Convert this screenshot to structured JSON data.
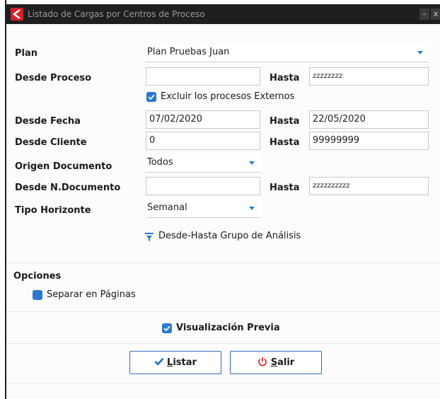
{
  "window": {
    "title": "Listado de Cargas por Centros de Proceso",
    "minimize_glyph": "–",
    "close_glyph": "x"
  },
  "form": {
    "plan": {
      "label": "Plan",
      "value": "Plan Pruebas Juan"
    },
    "desde_proceso": {
      "label": "Desde Proceso",
      "value": "",
      "hasta_label": "Hasta",
      "hasta_value": "zzzzzzzz"
    },
    "excluir": {
      "label": "Excluir los procesos Externos",
      "checked": true
    },
    "desde_fecha": {
      "label": "Desde Fecha",
      "value": "07/02/2020",
      "hasta_label": "Hasta",
      "hasta_value": "22/05/2020"
    },
    "desde_cliente": {
      "label": "Desde Cliente",
      "value": "0",
      "hasta_label": "Hasta",
      "hasta_value": "99999999"
    },
    "origen_documento": {
      "label": "Origen Documento",
      "value": "Todos"
    },
    "desde_documento": {
      "label": "Desde N.Documento",
      "value": "",
      "hasta_label": "Hasta",
      "hasta_value": "zzzzzzzzzz"
    },
    "tipo_horizonte": {
      "label": "Tipo Horizonte",
      "value": "Semanal"
    },
    "grupo_analisis": {
      "label": "Desde-Hasta Grupo de Análisis",
      "icon": "filter-icon"
    }
  },
  "opciones": {
    "heading": "Opciones",
    "separar": {
      "label": "Separar en Páginas",
      "checked": false
    }
  },
  "visualizacion": {
    "label": "Visualización Previa",
    "checked": true
  },
  "buttons": {
    "listar": {
      "underlined": "L",
      "rest": "istar",
      "icon": "checkmark-icon"
    },
    "salir": {
      "underlined": "S",
      "rest": "alir",
      "icon": "power-icon"
    }
  },
  "colors": {
    "accent": "#2b79d0",
    "titlebar": "#1f1f1f",
    "app_icon": "#d81e2a",
    "salir_icon": "#e02020"
  }
}
